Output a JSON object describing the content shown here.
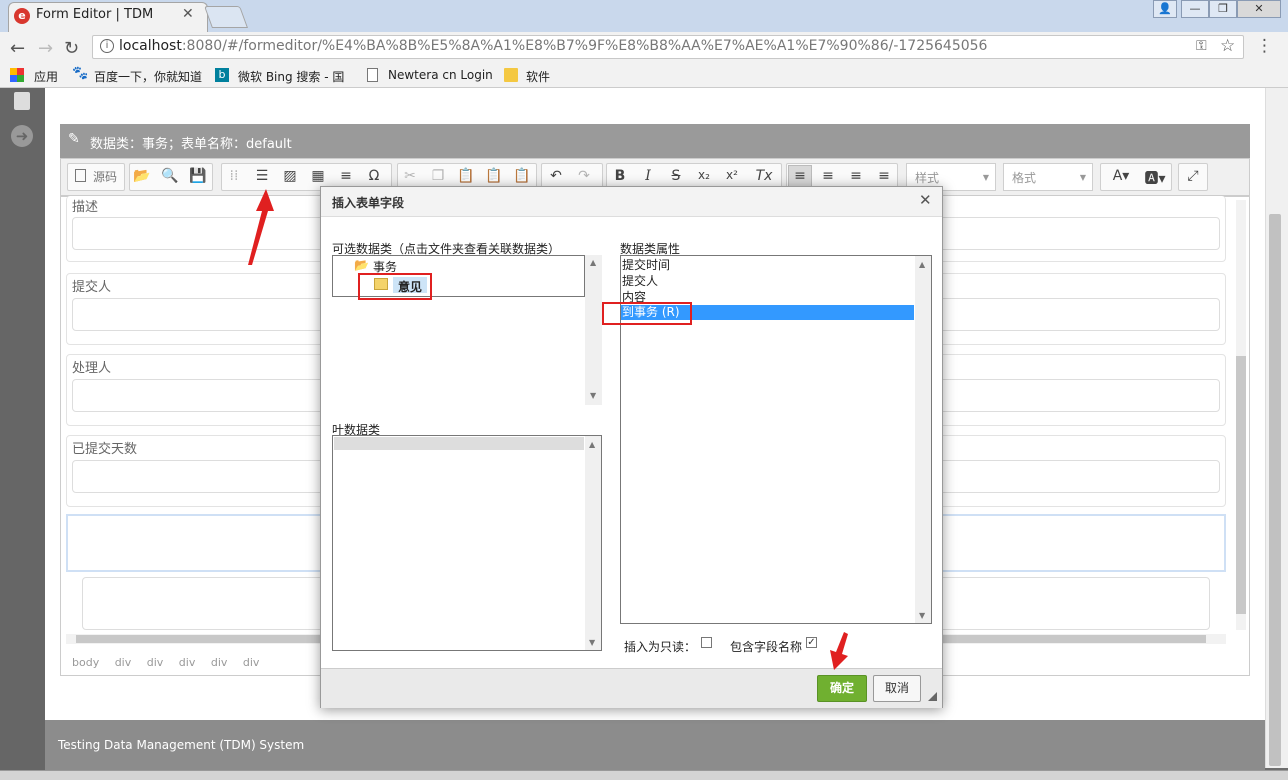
{
  "browser": {
    "tab_title": "Form Editor | TDM",
    "url_host": "localhost",
    "url_rest": ":8080/#/formeditor/%E4%BA%8B%E5%8A%A1%E8%B7%9F%E8%B8%AA%E7%AE%A1%E7%90%86/-1725645056",
    "bookmarks": [
      "应用",
      "百度一下，你就知道",
      "微软 Bing 搜索 - 国",
      "Newtera cn Login",
      "软件"
    ]
  },
  "panel": {
    "title": "数据类：事务；表单名称：default"
  },
  "toolbar": {
    "source_label": "源码",
    "style_select": "样式",
    "format_select": "格式"
  },
  "form": {
    "fields": [
      "描述",
      "提交人",
      "处理人",
      "已提交天数"
    ],
    "element_path": "body div div div div div"
  },
  "dialog": {
    "title": "插入表单字段",
    "classes_label": "可选数据类（点击文件夹查看关联数据类）",
    "tree_root": "事务",
    "tree_child": "意见",
    "leaf_label": "叶数据类",
    "attrs_label": "数据类属性",
    "attributes": [
      "提交时间",
      "提交人",
      "内容",
      "到事务 (R)"
    ],
    "selected_attribute": "到事务 (R)",
    "readonly_label": "插入为只读：",
    "readonly_checked": false,
    "include_name_label": "包含字段名称",
    "include_name_checked": true,
    "ok_label": "确定",
    "cancel_label": "取消"
  },
  "footer": {
    "text": "Testing Data Management (TDM) System"
  },
  "colors": {
    "ok_button": "#70b030",
    "selection": "#3399ff",
    "annotation": "#e02020"
  }
}
